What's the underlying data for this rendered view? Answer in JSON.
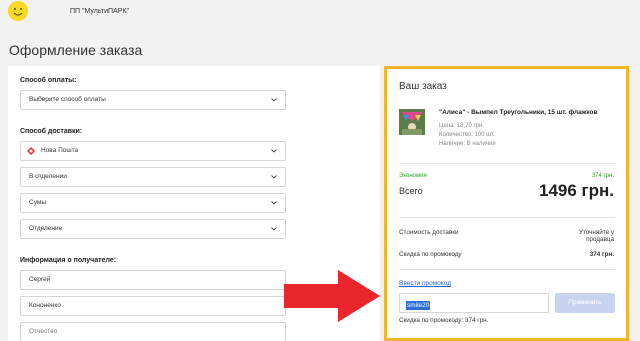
{
  "header": {
    "shop_name": "ПП \"МультиПАРК\""
  },
  "page": {
    "title": "Оформление заказа"
  },
  "checkout": {
    "payment_label": "Способ оплаты:",
    "payment_select": "Выберите способ оплаты",
    "delivery_label": "Способ доставки:",
    "delivery_carrier": "Нова Пошта",
    "delivery_type": "В отделении",
    "delivery_city": "Сумы",
    "delivery_branch": "Отделение",
    "recipient_label": "Информация о получателе:",
    "first_name": "Сергей",
    "last_name": "Кононенко",
    "patronymic_placeholder": "Отчество"
  },
  "order": {
    "title": "Ваш заказ",
    "product": {
      "name": "\"Алиса\" - Вымпел Треугольники, 15 шт. флажков",
      "price": "Цена: 18,70 грн.",
      "quantity": "Количество: 100 шт.",
      "availability": "Наличие: В наличии"
    },
    "economy_label": "Экономия",
    "economy_value": "374 грн.",
    "total_label": "Всего",
    "total_value": "1496 грн.",
    "delivery_cost_label": "Стоимость доставки",
    "delivery_cost_value_line1": "Уточняйте у",
    "delivery_cost_value_line2": "продавца",
    "promo_discount_label": "Скидка по промокоду",
    "promo_discount_value": "374 грн.",
    "promo_link": "Ввести промокод",
    "promo_code": "smile20",
    "apply_button": "Применить",
    "promo_note": "Скидка по промокоду: 374 грн."
  },
  "colors": {
    "order_border": "#f5b52b",
    "economy_green": "#2ba52f",
    "arrow_red": "#e8262b",
    "link_blue": "#2d5ec9"
  },
  "icons": [
    "smiley-logo-icon",
    "chevron-down-icon",
    "nova-poshta-icon",
    "red-arrow-icon"
  ]
}
